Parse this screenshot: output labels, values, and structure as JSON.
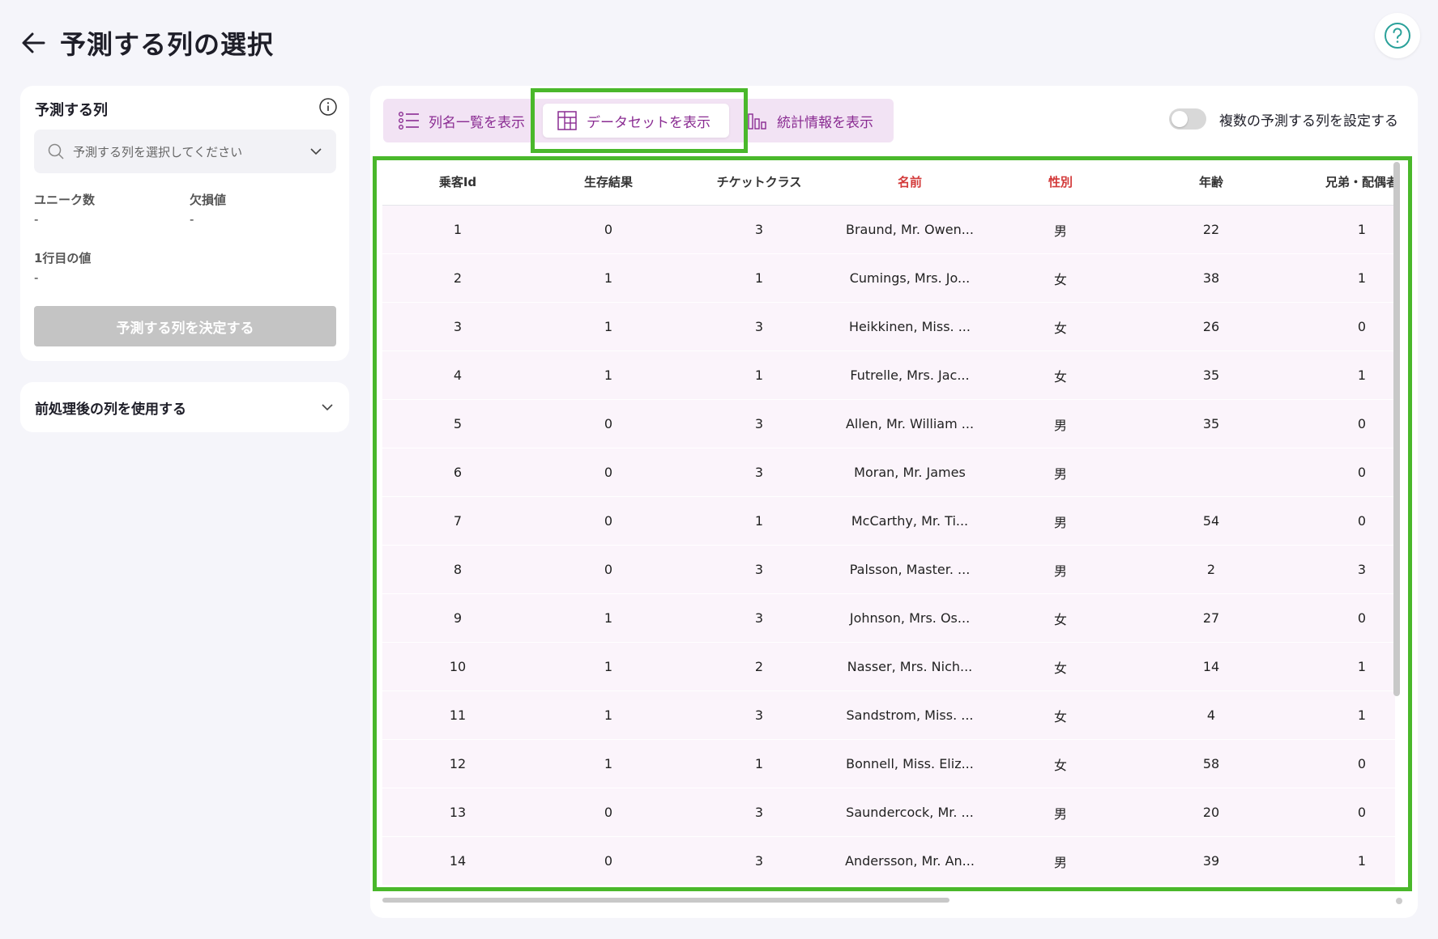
{
  "page": {
    "title": "予測する列の選択"
  },
  "target_panel": {
    "title": "予測する列",
    "select_placeholder": "予測する列を選択してください",
    "unique_label": "ユニーク数",
    "unique_value": "-",
    "missing_label": "欠損値",
    "missing_value": "-",
    "first_row_label": "1行目の値",
    "first_row_value": "-",
    "decide_button": "予測する列を決定する"
  },
  "preprocess_panel": {
    "label": "前処理後の列を使用する"
  },
  "tabs": {
    "column_list": "列名一覧を表示",
    "dataset": "データセットを表示",
    "stats": "統計情報を表示"
  },
  "toggle": {
    "label": "複数の予測する列を設定する"
  },
  "table": {
    "headers": [
      "乗客Id",
      "生存結果",
      "チケットクラス",
      "名前",
      "性別",
      "年齢",
      "兄弟・配偶者"
    ],
    "rows": [
      [
        "1",
        "0",
        "3",
        "Braund, Mr. Owen...",
        "男",
        "22",
        "1"
      ],
      [
        "2",
        "1",
        "1",
        "Cumings, Mrs. Jo...",
        "女",
        "38",
        "1"
      ],
      [
        "3",
        "1",
        "3",
        "Heikkinen, Miss. ...",
        "女",
        "26",
        "0"
      ],
      [
        "4",
        "1",
        "1",
        "Futrelle, Mrs. Jac...",
        "女",
        "35",
        "1"
      ],
      [
        "5",
        "0",
        "3",
        "Allen, Mr. William ...",
        "男",
        "35",
        "0"
      ],
      [
        "6",
        "0",
        "3",
        "Moran, Mr. James",
        "男",
        "",
        "0"
      ],
      [
        "7",
        "0",
        "1",
        "McCarthy, Mr. Ti...",
        "男",
        "54",
        "0"
      ],
      [
        "8",
        "0",
        "3",
        "Palsson, Master. ...",
        "男",
        "2",
        "3"
      ],
      [
        "9",
        "1",
        "3",
        "Johnson, Mrs. Os...",
        "女",
        "27",
        "0"
      ],
      [
        "10",
        "1",
        "2",
        "Nasser, Mrs. Nich...",
        "女",
        "14",
        "1"
      ],
      [
        "11",
        "1",
        "3",
        "Sandstrom, Miss. ...",
        "女",
        "4",
        "1"
      ],
      [
        "12",
        "1",
        "1",
        "Bonnell, Miss. Eliz...",
        "女",
        "58",
        "0"
      ],
      [
        "13",
        "0",
        "3",
        "Saundercock, Mr. ...",
        "男",
        "20",
        "0"
      ],
      [
        "14",
        "0",
        "3",
        "Andersson, Mr. An...",
        "男",
        "39",
        "1"
      ]
    ]
  },
  "colors": {
    "accent": "#8a2c92",
    "highlight": "#4ab82b",
    "header_red": "#d33a3a",
    "help_icon": "#2aa19a"
  }
}
